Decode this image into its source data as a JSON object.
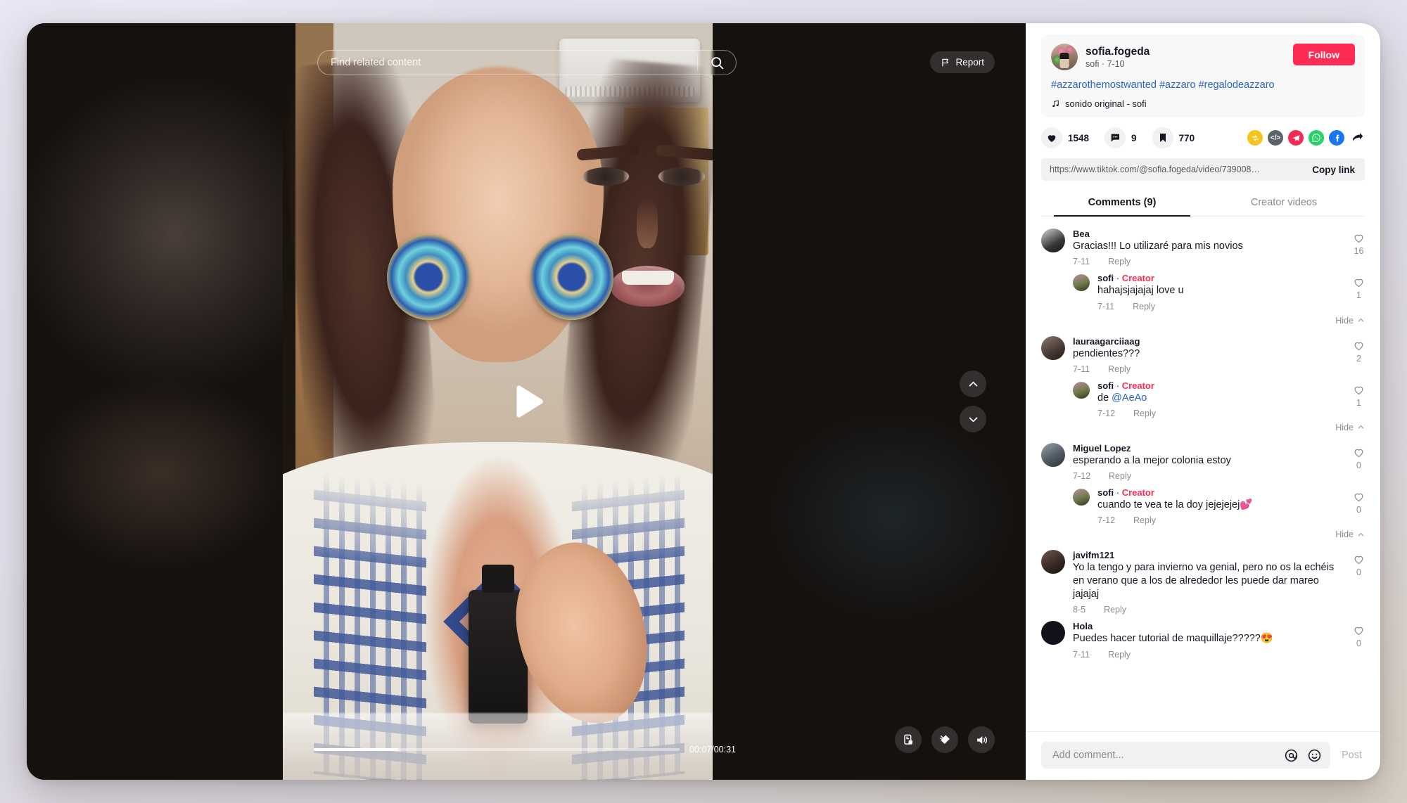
{
  "video": {
    "search_placeholder": "Find related content",
    "search_icon": "search-icon",
    "report_label": "Report",
    "report_icon": "flag-icon",
    "play_icon": "play-icon",
    "nav_up_icon": "chevron-up-icon",
    "nav_down_icon": "chevron-down-icon",
    "current_time": "00:07",
    "duration": "00:31",
    "time_label": "00:07/00:31",
    "progress_percent": 23,
    "controls": [
      {
        "name": "auto-scroll-icon",
        "label": "Auto scroll"
      },
      {
        "name": "clean-mode-icon",
        "label": "Clean mode"
      },
      {
        "name": "volume-icon",
        "label": "Volume"
      }
    ]
  },
  "author": {
    "name": "sofia.fogeda",
    "handle": "sofi",
    "date": "7-10",
    "subtitle": "sofi · 7-10",
    "follow_label": "Follow",
    "caption": "#azzarothemostwanted #azzaro #regalodeazzaro",
    "music": "sonido original - sofi",
    "music_icon": "music-note-icon"
  },
  "stats": {
    "likes": "1548",
    "comments": "9",
    "bookmarks": "770",
    "like_icon": "heart-icon",
    "comment_icon": "comment-bubble-icon",
    "bookmark_icon": "bookmark-icon"
  },
  "share": {
    "items": [
      {
        "name": "repost-icon",
        "color": "#F7C31D"
      },
      {
        "name": "embed-code-icon",
        "color": "#5C6269"
      },
      {
        "name": "telegram-icon",
        "color": "#F42A54"
      },
      {
        "name": "whatsapp-icon",
        "color": "#25D366"
      },
      {
        "name": "facebook-icon",
        "color": "#1877F2"
      },
      {
        "name": "share-arrow-icon",
        "color": "#161823"
      }
    ]
  },
  "link": {
    "url": "https://www.tiktok.com/@sofia.fogeda/video/739008…",
    "copy_label": "Copy link"
  },
  "tabs": [
    {
      "label": "Comments (9)",
      "active": true
    },
    {
      "label": "Creator videos",
      "active": false
    }
  ],
  "comments": [
    {
      "name": "Bea",
      "text": "Gracias!!! Lo utilizaré para mis novios",
      "date": "7-11",
      "reply_label": "Reply",
      "likes": "16",
      "is_creator": false,
      "avatar_style": "bw-photo",
      "reply": {
        "name": "sofi",
        "creator_label": "Creator",
        "text": "hahajsjajajaj love u",
        "date": "7-11",
        "reply_label": "Reply",
        "likes": "1",
        "is_creator": true
      },
      "hide_label": "Hide"
    },
    {
      "name": "lauraagarciiaag",
      "text": "pendientes???",
      "date": "7-11",
      "reply_label": "Reply",
      "likes": "2",
      "is_creator": false,
      "avatar_style": "dark-photo",
      "reply": {
        "name": "sofi",
        "creator_label": "Creator",
        "text_prefix": "de ",
        "mention": "@AeAo",
        "date": "7-12",
        "reply_label": "Reply",
        "likes": "1",
        "is_creator": true
      },
      "hide_label": "Hide"
    },
    {
      "name": "Miguel Lopez",
      "text": "esperando a la mejor colonia estoy",
      "date": "7-12",
      "reply_label": "Reply",
      "likes": "0",
      "is_creator": false,
      "avatar_style": "light-photo",
      "reply": {
        "name": "sofi",
        "creator_label": "Creator",
        "text": "cuando te vea te la doy jejejejej💕",
        "date": "7-12",
        "reply_label": "Reply",
        "likes": "0",
        "is_creator": true
      },
      "hide_label": "Hide"
    },
    {
      "name": "javifm121",
      "text": "Yo la tengo y para invierno va genial, pero no os la echéis en verano que a los de alrededor les puede dar mareo jajajaj",
      "date": "8-5",
      "reply_label": "Reply",
      "likes": "0",
      "is_creator": false,
      "avatar_style": "sunglasses-photo"
    },
    {
      "name": "Hola",
      "text": "Puedes hacer tutorial de maquillaje?????😍",
      "date": "7-11",
      "reply_label": "Reply",
      "likes": "0",
      "is_creator": false,
      "avatar_style": "black-photo"
    }
  ],
  "composer": {
    "placeholder": "Add comment...",
    "mention_icon": "at-mention-icon",
    "emoji_icon": "emoji-smiley-icon",
    "post_label": "Post"
  }
}
